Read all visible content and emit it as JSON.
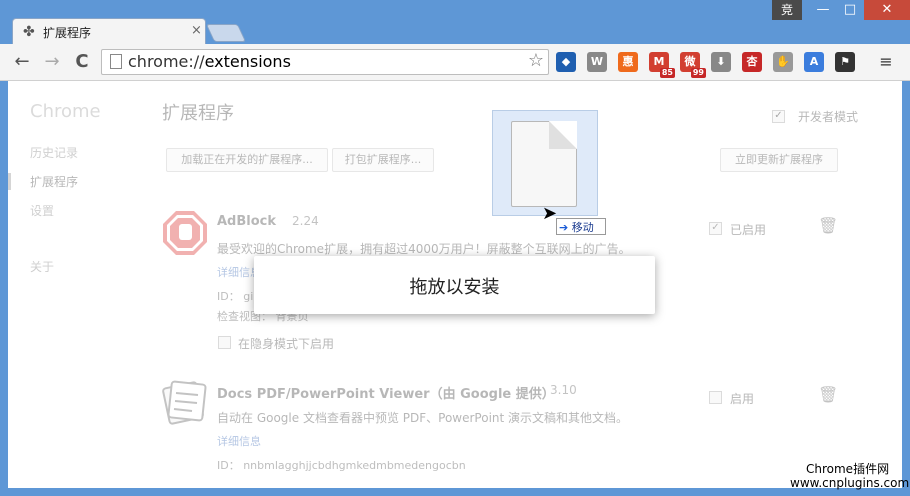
{
  "window": {
    "badge": "竞",
    "minimize": "—",
    "maximize": "□",
    "close": "✕"
  },
  "tab": {
    "title": "扩展程序",
    "close": "×"
  },
  "toolbar": {
    "back": "←",
    "forward": "→",
    "reload": "C",
    "url_scheme": "chrome://",
    "url_host": "extensions",
    "star": "☆",
    "extensions": [
      {
        "icon": "dropbox-icon",
        "label": "◆",
        "color": "#1f5fb0"
      },
      {
        "icon": "wikipedia-icon",
        "label": "W",
        "color": "#888888"
      },
      {
        "icon": "huiyi-icon",
        "label": "惠",
        "color": "#ef6a1c"
      },
      {
        "icon": "gmail-icon",
        "label": "M",
        "badge": "85",
        "color": "#d23f31"
      },
      {
        "icon": "weibo-icon",
        "label": "微",
        "badge": "99",
        "color": "#d23f31"
      },
      {
        "icon": "download-icon",
        "label": "⬇",
        "color": "#888888"
      },
      {
        "icon": "xing-icon",
        "label": "杏",
        "color": "#c62828"
      },
      {
        "icon": "adblock-icon",
        "label": "✋",
        "color": "#999999"
      },
      {
        "icon": "translate-icon",
        "label": "A",
        "color": "#3b7ddd"
      },
      {
        "icon": "flag-icon",
        "label": "⚑",
        "color": "#333333"
      }
    ],
    "menu": "≡"
  },
  "sidebar": {
    "brand": "Chrome",
    "items": [
      {
        "label": "历史记录"
      },
      {
        "label": "扩展程序"
      },
      {
        "label": "设置"
      },
      {
        "label": "关于"
      }
    ]
  },
  "main": {
    "heading": "扩展程序",
    "developer_mode": "开发者模式",
    "buttons": {
      "load_unpacked": "加载正在开发的扩展程序...",
      "pack": "打包扩展程序...",
      "update": "立即更新扩展程序"
    },
    "extensions": [
      {
        "name": "AdBlock",
        "version": "2.24",
        "description": "最受欢迎的Chrome扩展，拥有超过4000万用户！屏蔽整个互联网上的广告。",
        "details_link": "详细信息",
        "id_text": "ID： gi",
        "inspect_text": "检查视图： 背景页",
        "incognito": "在隐身模式下启用",
        "enabled_label": "已启用",
        "enabled": true
      },
      {
        "name": "Docs PDF/PowerPoint Viewer（由 Google 提供）",
        "version": "3.10",
        "description": "自动在 Google 文档查看器中预览 PDF、PowerPoint 演示文稿和其他文档。",
        "details_link": "详细信息",
        "id_text": "ID： nnbmlagghjjcbdhgmkedmbmedengocbn",
        "enabled_label": "启用",
        "enabled": false
      }
    ]
  },
  "drag": {
    "tooltip": "移动",
    "arrow": "➔"
  },
  "drop": {
    "text": "拖放以安装"
  },
  "watermark": {
    "line1": "Chrome插件网",
    "line2": "www.cnplugins.com"
  }
}
